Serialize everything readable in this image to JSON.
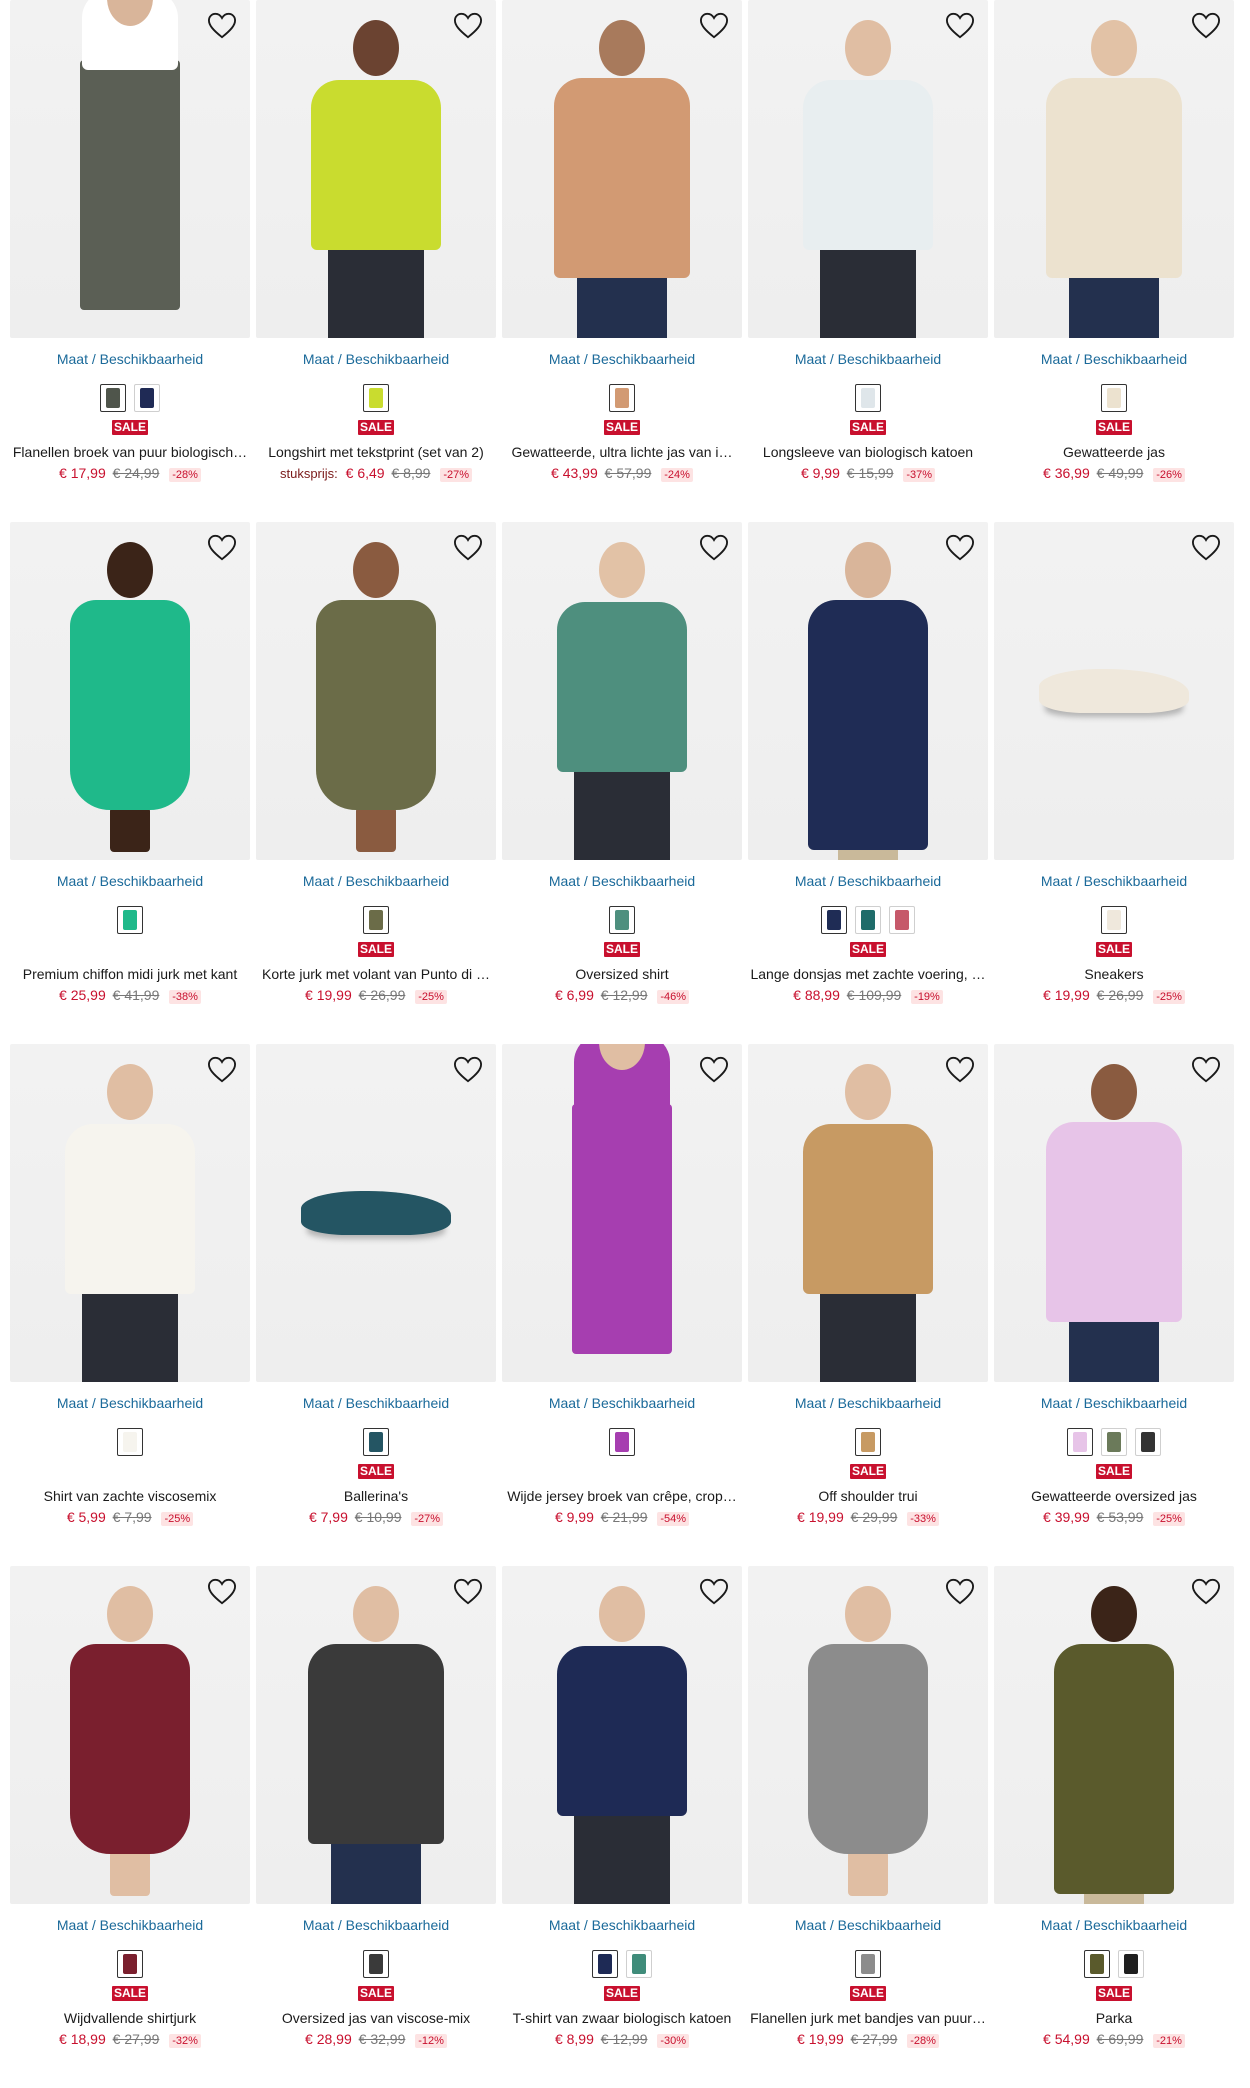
{
  "availability_label": "Maat / Beschikbaarheid",
  "sale_label": "SALE",
  "products": [
    {
      "name": "Flanellen broek van puur biologisch…",
      "unit_label": "",
      "price": "€ 17,99",
      "old_price": "€ 24,99",
      "discount": "-28%",
      "sale": true,
      "bg": "#eeeeee",
      "garment": "#5b5f55",
      "top": "#ffffff",
      "skin": "#d9b59a",
      "kind": "pants",
      "swatches": [
        "#4f554b",
        "#1f2a55"
      ]
    },
    {
      "name": "Longshirt met tekstprint (set van 2)",
      "unit_label": "stuksprijs:",
      "price": "€ 6,49",
      "old_price": "€ 8,99",
      "discount": "-27%",
      "sale": true,
      "bg": "#eeeeee",
      "garment": "#c9dc2f",
      "top": "#c9dc2f",
      "skin": "#6b4331",
      "kind": "top",
      "swatches": [
        "#c9dc2f"
      ]
    },
    {
      "name": "Gewatteerde, ultra lichte jas van i…",
      "unit_label": "",
      "price": "€ 43,99",
      "old_price": "€ 57,99",
      "discount": "-24%",
      "sale": true,
      "bg": "#eeeeee",
      "garment": "#d29a73",
      "top": "#d29a73",
      "skin": "#a87a5c",
      "kind": "jacket",
      "swatches": [
        "#d29a73"
      ]
    },
    {
      "name": "Longsleeve van biologisch katoen",
      "unit_label": "",
      "price": "€ 9,99",
      "old_price": "€ 15,99",
      "discount": "-37%",
      "sale": true,
      "bg": "#eeeeee",
      "garment": "#e8eef0",
      "top": "#e8eef0",
      "skin": "#e0bea3",
      "kind": "top",
      "swatches": [
        "#dfe6ea"
      ]
    },
    {
      "name": "Gewatteerde jas",
      "unit_label": "",
      "price": "€ 36,99",
      "old_price": "€ 49,99",
      "discount": "-26%",
      "sale": true,
      "bg": "#eeeeee",
      "garment": "#ece2cf",
      "top": "#ece2cf",
      "skin": "#e2c2a6",
      "kind": "jacket",
      "swatches": [
        "#ece2cf"
      ]
    },
    {
      "name": "Premium chiffon midi jurk met kant",
      "unit_label": "",
      "price": "€ 25,99",
      "old_price": "€ 41,99",
      "discount": "-38%",
      "sale": false,
      "bg": "#eeeeee",
      "garment": "#1fb98a",
      "top": "#1fb98a",
      "skin": "#3b2418",
      "kind": "dress",
      "swatches": [
        "#1fb98a"
      ]
    },
    {
      "name": "Korte jurk met volant van Punto di …",
      "unit_label": "",
      "price": "€ 19,99",
      "old_price": "€ 26,99",
      "discount": "-25%",
      "sale": true,
      "bg": "#eeeeee",
      "garment": "#6b6c48",
      "top": "#6b6c48",
      "skin": "#8a5b40",
      "kind": "dress",
      "swatches": [
        "#6b6c48"
      ]
    },
    {
      "name": "Oversized shirt",
      "unit_label": "",
      "price": "€ 6,99",
      "old_price": "€ 12,99",
      "discount": "-46%",
      "sale": true,
      "bg": "#eeeeee",
      "garment": "#4e8f7e",
      "top": "#4e8f7e",
      "skin": "#e2c2a6",
      "kind": "top",
      "swatches": [
        "#4e8f7e"
      ]
    },
    {
      "name": "Lange donsjas met zachte voering, …",
      "unit_label": "",
      "price": "€ 88,99",
      "old_price": "€ 109,99",
      "discount": "-19%",
      "sale": true,
      "bg": "#eeeeee",
      "garment": "#1f2c55",
      "top": "#1f2c55",
      "skin": "#d9b59a",
      "kind": "coat",
      "swatches": [
        "#1f2c55",
        "#1f6c6a",
        "#c6596a"
      ]
    },
    {
      "name": "Sneakers",
      "unit_label": "",
      "price": "€ 19,99",
      "old_price": "€ 26,99",
      "discount": "-25%",
      "sale": true,
      "bg": "#eeeeee",
      "garment": "#efe8dc",
      "top": "#efe8dc",
      "skin": "#efe8dc",
      "kind": "shoe",
      "swatches": [
        "#efe8dc"
      ]
    },
    {
      "name": "Shirt van zachte viscosemix",
      "unit_label": "",
      "price": "€ 5,99",
      "old_price": "€ 7,99",
      "discount": "-25%",
      "sale": false,
      "bg": "#eeeeee",
      "garment": "#f6f4ee",
      "top": "#f6f4ee",
      "skin": "#e0bea3",
      "kind": "top",
      "swatches": [
        "#f6f4ee"
      ]
    },
    {
      "name": "Ballerina's",
      "unit_label": "",
      "price": "€ 7,99",
      "old_price": "€ 10,99",
      "discount": "-27%",
      "sale": true,
      "bg": "#eeeeee",
      "garment": "#245563",
      "top": "#245563",
      "skin": "#245563",
      "kind": "shoe",
      "swatches": [
        "#245563"
      ]
    },
    {
      "name": "Wijde jersey broek van crêpe, crop…",
      "unit_label": "",
      "price": "€ 9,99",
      "old_price": "€ 21,99",
      "discount": "-54%",
      "sale": false,
      "bg": "#eeeeee",
      "garment": "#a63eb0",
      "top": "#a63eb0",
      "skin": "#e0bea3",
      "kind": "pants",
      "swatches": [
        "#a63eb0"
      ]
    },
    {
      "name": "Off shoulder trui",
      "unit_label": "",
      "price": "€ 19,99",
      "old_price": "€ 29,99",
      "discount": "-33%",
      "sale": true,
      "bg": "#eeeeee",
      "garment": "#c79a63",
      "top": "#c79a63",
      "skin": "#e0bea3",
      "kind": "top",
      "swatches": [
        "#c79a63"
      ]
    },
    {
      "name": "Gewatteerde oversized jas",
      "unit_label": "",
      "price": "€ 39,99",
      "old_price": "€ 53,99",
      "discount": "-25%",
      "sale": true,
      "bg": "#eeeeee",
      "garment": "#e7c4e8",
      "top": "#e7c4e8",
      "skin": "#8a5b40",
      "kind": "jacket",
      "swatches": [
        "#e7c4e8",
        "#6b7a5a",
        "#333333"
      ]
    },
    {
      "name": "Wijdvallende shirtjurk",
      "unit_label": "",
      "price": "€ 18,99",
      "old_price": "€ 27,99",
      "discount": "-32%",
      "sale": true,
      "bg": "#eeeeee",
      "garment": "#7a1f2e",
      "top": "#7a1f2e",
      "skin": "#e0bea3",
      "kind": "dress",
      "swatches": [
        "#7a1f2e"
      ]
    },
    {
      "name": "Oversized jas van viscose-mix",
      "unit_label": "",
      "price": "€ 28,99",
      "old_price": "€ 32,99",
      "discount": "-12%",
      "sale": true,
      "bg": "#eeeeee",
      "garment": "#3a3a3a",
      "top": "#3a3a3a",
      "skin": "#e0bea3",
      "kind": "jacket",
      "swatches": [
        "#3a3a3a"
      ]
    },
    {
      "name": "T-shirt van zwaar biologisch katoen",
      "unit_label": "",
      "price": "€ 8,99",
      "old_price": "€ 12,99",
      "discount": "-30%",
      "sale": true,
      "bg": "#eeeeee",
      "garment": "#1e2a55",
      "top": "#1e2a55",
      "skin": "#e0bea3",
      "kind": "top",
      "swatches": [
        "#1e2a55",
        "#3f8c7a"
      ]
    },
    {
      "name": "Flanellen jurk met bandjes van puur…",
      "unit_label": "",
      "price": "€ 19,99",
      "old_price": "€ 27,99",
      "discount": "-28%",
      "sale": true,
      "bg": "#eeeeee",
      "garment": "#8c8c8c",
      "top": "#f1f1f1",
      "skin": "#e0bea3",
      "kind": "dress",
      "swatches": [
        "#8c8c8c"
      ]
    },
    {
      "name": "Parka",
      "unit_label": "",
      "price": "€ 54,99",
      "old_price": "€ 69,99",
      "discount": "-21%",
      "sale": true,
      "bg": "#eeeeee",
      "garment": "#5a5a2c",
      "top": "#5a5a2c",
      "skin": "#3b2418",
      "kind": "coat",
      "swatches": [
        "#5a5a2c",
        "#1f1f1f"
      ]
    }
  ]
}
